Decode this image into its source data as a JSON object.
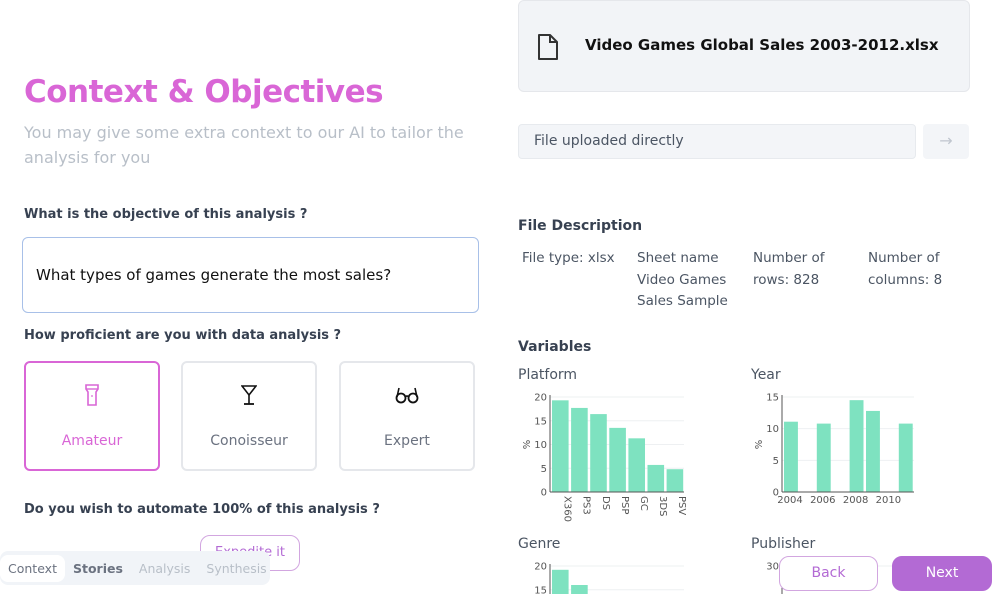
{
  "context": {
    "title": "Context & Objectives",
    "subtitle": "You may give some extra context to our AI to tailor the analysis for you",
    "objective_question": "What is the objective of this analysis ?",
    "objective_value": "What types of games generate the most sales?",
    "proficiency_question": "How proficient are you with data analysis ?",
    "proficiency_options": [
      {
        "label": "Amateur",
        "icon": "flashlight-icon",
        "selected": true
      },
      {
        "label": "Conoisseur",
        "icon": "cocktail-glass-icon",
        "selected": false
      },
      {
        "label": "Expert",
        "icon": "glasses-icon",
        "selected": false
      }
    ],
    "automate_question": "Do you wish to automate 100% of this analysis ?",
    "expedite_label": "Expedite it"
  },
  "steps": [
    {
      "label": "Context",
      "state": "active"
    },
    {
      "label": "Stories",
      "state": "done"
    },
    {
      "label": "Analysis",
      "state": "disabled"
    },
    {
      "label": "Synthesis",
      "state": "disabled"
    }
  ],
  "file": {
    "name": "Video Games Global Sales 2003-2012.xlsx",
    "icon": "file-icon",
    "source": "File uploaded directly",
    "description_title": "File Description",
    "file_type": "File type: xlsx",
    "sheet_name": "Sheet name Video Games Sales Sample",
    "rows": "Number of rows: 828",
    "columns": "Number of columns: 8",
    "variables_title": "Variables"
  },
  "nav": {
    "back": "Back",
    "next": "Next"
  },
  "colors": {
    "accent": "#d966d6",
    "button": "#b36ad4",
    "bar": "#7ee2c0"
  },
  "chart_data": [
    {
      "type": "bar",
      "title": "Platform",
      "ylabel": "%",
      "ylim": [
        0,
        20
      ],
      "yticks": [
        0,
        5,
        10,
        15,
        20
      ],
      "categories": [
        "X360",
        "PS3",
        "DS",
        "PSP",
        "GC",
        "3DS",
        "PSV"
      ],
      "values": [
        19.3,
        17.7,
        16.4,
        13.5,
        11.3,
        5.7,
        4.8
      ]
    },
    {
      "type": "bar",
      "title": "Year",
      "ylabel": "%",
      "ylim": [
        0,
        15
      ],
      "yticks": [
        0,
        5,
        10,
        15
      ],
      "categories": [
        2004,
        2005,
        2006,
        2007,
        2008,
        2009,
        2010,
        2011
      ],
      "xticks": [
        "2004",
        "2006",
        "2008",
        "2010"
      ],
      "values": [
        11.1,
        0,
        10.8,
        0,
        14.5,
        12.8,
        0,
        10.8
      ]
    },
    {
      "type": "bar",
      "title": "Genre",
      "ylim": [
        0,
        20
      ],
      "yticks": [
        15,
        20
      ],
      "values": [
        19.2,
        16.0
      ]
    },
    {
      "type": "bar",
      "title": "Publisher",
      "ylim": [
        0,
        30
      ],
      "yticks": [
        30
      ],
      "values": []
    }
  ]
}
